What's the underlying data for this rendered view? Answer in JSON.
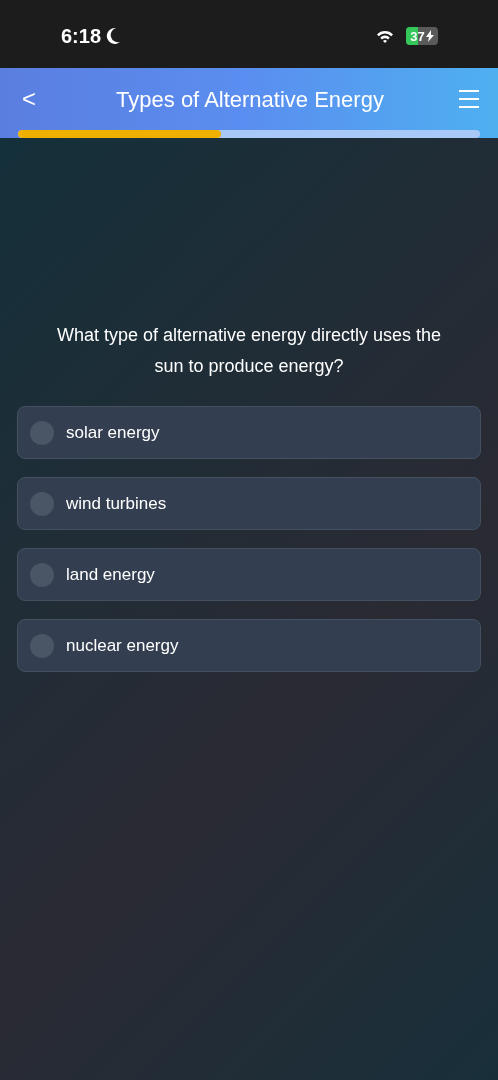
{
  "status_bar": {
    "time": "6:18",
    "battery": "37"
  },
  "header": {
    "back": "<",
    "title": "Types of Alternative Energy",
    "progress": {
      "level": 0.44
    }
  },
  "question": "What type of alternative energy directly uses the sun to produce energy?",
  "options": [
    {
      "label": "solar energy",
      "selected": false
    },
    {
      "label": "wind turbines",
      "selected": false
    },
    {
      "label": "land energy",
      "selected": false
    },
    {
      "label": "nuclear energy",
      "selected": false
    }
  ]
}
